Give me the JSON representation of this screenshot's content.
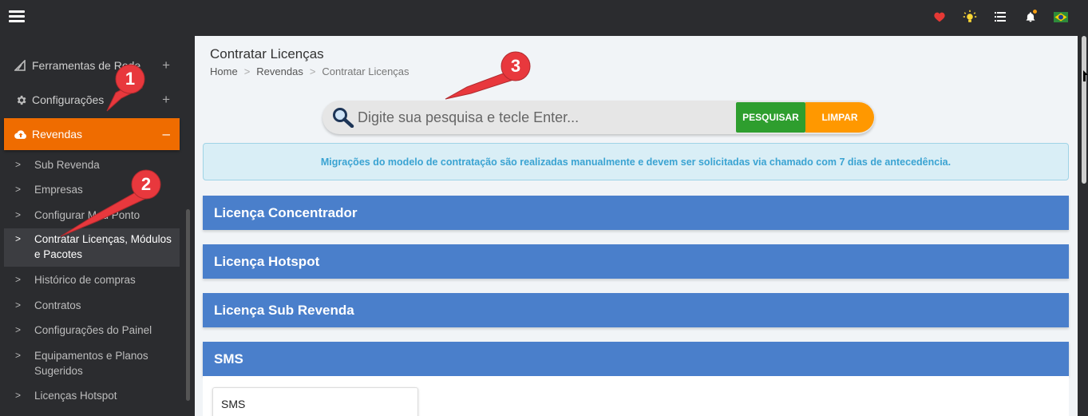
{
  "topbar": {
    "icons": [
      "heart-icon",
      "lightbulb-icon",
      "list-icon",
      "bell-icon",
      "brazil-flag-icon"
    ],
    "colors": {
      "heart": "#e53935",
      "lightbulb": "#fdd835",
      "flag_green": "#2e8b3a",
      "flag_yellow": "#f5d000"
    }
  },
  "sidebar": {
    "menu": [
      {
        "label": "Ferramentas de Rede",
        "icon": "network-tools-icon",
        "toggle": "+"
      },
      {
        "label": "Configurações",
        "icon": "gear-icon",
        "toggle": "+"
      },
      {
        "label": "Revendas",
        "icon": "cloud-upload-icon",
        "toggle": "–"
      }
    ],
    "submenu": [
      "Sub Revenda",
      "Empresas",
      "Configurar Meu Ponto",
      "Contratar Licenças, Módulos e Pacotes",
      "Histórico de compras",
      "Contratos",
      "Configurações do Painel",
      "Equipamentos e Planos Sugeridos",
      "Licenças Hotspot"
    ]
  },
  "main": {
    "title": "Contratar Licenças",
    "breadcrumb": [
      "Home",
      "Revendas",
      "Contratar Licenças"
    ],
    "breadcrumb_sep": ">",
    "search": {
      "placeholder": "Digite sua pesquisa e tecle Enter...",
      "search_label": "PESQUISAR",
      "clear_label": "LIMPAR"
    },
    "alert": "Migrações do modelo de contratação são realizadas manualmente e devem ser solicitadas via chamado com 7 dias de antecedência.",
    "panels": [
      "Licença Concentrador",
      "Licença Hotspot",
      "Licença Sub Revenda",
      "SMS"
    ],
    "sms_card": "SMS"
  },
  "annotations": {
    "badges": [
      "1",
      "2",
      "3"
    ],
    "color": "#e8383d"
  }
}
